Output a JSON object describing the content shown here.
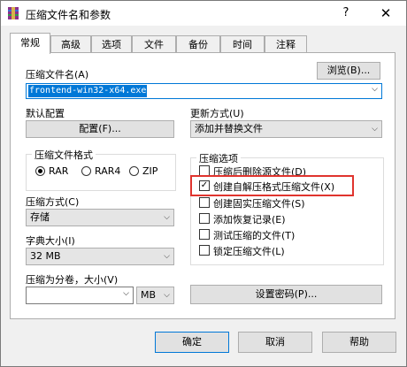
{
  "window": {
    "title": "压缩文件名和参数",
    "help_glyph": "?",
    "close_glyph": "✕"
  },
  "tabs": [
    {
      "label": "常规",
      "active": true
    },
    {
      "label": "高级",
      "active": false
    },
    {
      "label": "选项",
      "active": false
    },
    {
      "label": "文件",
      "active": false
    },
    {
      "label": "备份",
      "active": false
    },
    {
      "label": "时间",
      "active": false
    },
    {
      "label": "注释",
      "active": false
    }
  ],
  "archive": {
    "label": "压缩文件名(A)",
    "value": "frontend-win32-x64.exe",
    "browse_label": "浏览(B)..."
  },
  "profile": {
    "label": "默认配置",
    "button_label": "配置(F)..."
  },
  "update": {
    "label": "更新方式(U)",
    "value": "添加并替换文件"
  },
  "format": {
    "label": "压缩文件格式",
    "options": [
      {
        "label": "RAR",
        "selected": true
      },
      {
        "label": "RAR4",
        "selected": false
      },
      {
        "label": "ZIP",
        "selected": false
      }
    ]
  },
  "method": {
    "label": "压缩方式(C)",
    "value": "存储"
  },
  "dictionary": {
    "label": "字典大小(I)",
    "value": "32 MB"
  },
  "split": {
    "label": "压缩为分卷，大小(V)",
    "value": "",
    "unit": "MB"
  },
  "options": {
    "label": "压缩选项",
    "items": [
      {
        "label": "压缩后删除源文件(D)",
        "checked": false,
        "highlighted": false
      },
      {
        "label": "创建自解压格式压缩文件(X)",
        "checked": true,
        "highlighted": true
      },
      {
        "label": "创建固实压缩文件(S)",
        "checked": false,
        "highlighted": false
      },
      {
        "label": "添加恢复记录(E)",
        "checked": false,
        "highlighted": false
      },
      {
        "label": "测试压缩的文件(T)",
        "checked": false,
        "highlighted": false
      },
      {
        "label": "锁定压缩文件(L)",
        "checked": false,
        "highlighted": false
      }
    ]
  },
  "password_button": "设置密码(P)...",
  "buttons": {
    "ok": "确定",
    "cancel": "取消",
    "help": "帮助"
  },
  "colors": {
    "highlight": "#e0342e",
    "selection": "#0078d7",
    "accent_border": "#0078d7"
  }
}
